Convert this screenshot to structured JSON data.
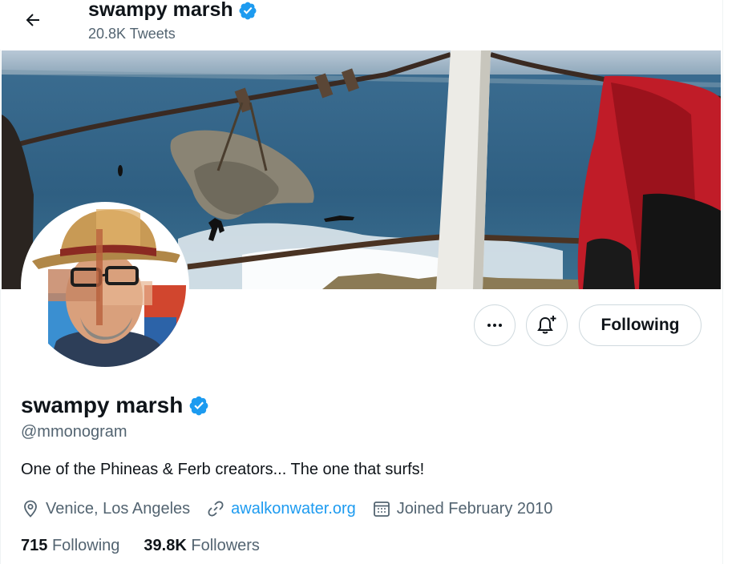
{
  "header": {
    "name": "swampy marsh",
    "tweet_count": "20.8K Tweets",
    "back_icon": "arrow-left-icon"
  },
  "profile": {
    "display_name": "swampy marsh",
    "handle": "@mmonogram",
    "verified": true,
    "bio": "One of the Phineas & Ferb creators... The one that surfs!",
    "location": "Venice, Los Angeles",
    "website": "awalkonwater.org",
    "joined": "Joined February 2010"
  },
  "actions": {
    "more_icon": "ellipsis-icon",
    "notify_icon": "bell-plus-icon",
    "following_label": "Following"
  },
  "stats": {
    "following_count": "715",
    "following_label": "Following",
    "followers_count": "39.8K",
    "followers_label": "Followers"
  },
  "colors": {
    "accent": "#1d9bf0",
    "secondary_text": "#536471",
    "primary_text": "#0f1419"
  }
}
